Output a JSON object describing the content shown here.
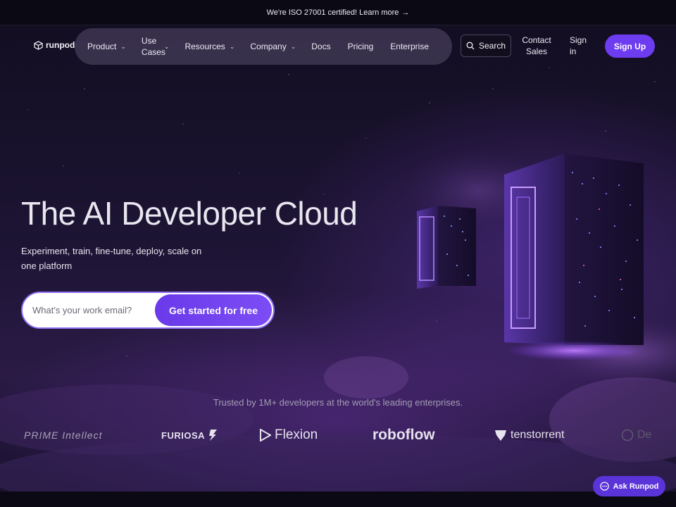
{
  "announcement": {
    "text": "We're ISO 27001 certified! Learn more",
    "arrow": "→"
  },
  "brand": {
    "name": "runpod"
  },
  "nav": {
    "items": [
      {
        "label": "Product",
        "dropdown": true
      },
      {
        "label": "Use Cases",
        "dropdown": true
      },
      {
        "label": "Resources",
        "dropdown": true
      },
      {
        "label": "Company",
        "dropdown": true
      },
      {
        "label": "Docs",
        "dropdown": false
      },
      {
        "label": "Pricing",
        "dropdown": false
      },
      {
        "label": "Enterprise",
        "dropdown": false
      }
    ],
    "search_label": "Search",
    "contact_label": "Contact Sales",
    "signin_label": "Sign in",
    "signup_label": "Sign Up"
  },
  "hero": {
    "headline": "The AI Developer Cloud",
    "subhead": "Experiment, train, fine-tune, deploy, scale on one platform",
    "email_placeholder": "What's your work email?",
    "cta_label": "Get started for free"
  },
  "trusted": {
    "text": "Trusted by 1M+ developers at the world's leading enterprises.",
    "logos": [
      "PRIME Intellect",
      "FURIOSA",
      "Flexion",
      "roboflow",
      "tenstorrent",
      "De"
    ]
  },
  "chat": {
    "label": "Ask Runpod"
  },
  "colors": {
    "accent": "#6d3bf0",
    "background": "#0d0a17",
    "hero_glow": "#7c4cf5"
  }
}
